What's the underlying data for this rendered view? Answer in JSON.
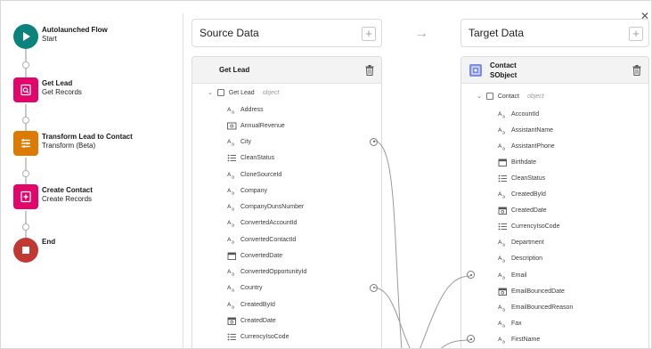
{
  "flow": {
    "steps": [
      {
        "title": "Autolaunched Flow",
        "subtitle": "Start",
        "icon": "play-icon",
        "color": "#0b827c",
        "shape": "circle"
      },
      {
        "title": "Get Lead",
        "subtitle": "Get Records",
        "icon": "search-record-icon",
        "color": "#e3066a",
        "shape": "square"
      },
      {
        "title": "Transform Lead to Contact",
        "subtitle": "Transform (Beta)",
        "icon": "transform-icon",
        "color": "#dd7a01",
        "shape": "square"
      },
      {
        "title": "Create Contact",
        "subtitle": "Create Records",
        "icon": "add-record-icon",
        "color": "#e3066a",
        "shape": "square"
      },
      {
        "title": "End",
        "subtitle": "",
        "icon": "stop-icon",
        "color": "#c23934",
        "shape": "circle"
      }
    ]
  },
  "source": {
    "header_title": "Source Data",
    "add_symbol": "+",
    "panel_title": "Get Lead",
    "root_label": "Get Lead",
    "root_type": "object",
    "fields": [
      {
        "name": "Address",
        "icon": "text"
      },
      {
        "name": "AnnualRevenue",
        "icon": "currency"
      },
      {
        "name": "City",
        "icon": "text",
        "connected": true
      },
      {
        "name": "CleanStatus",
        "icon": "list"
      },
      {
        "name": "CloneSourceId",
        "icon": "text"
      },
      {
        "name": "Company",
        "icon": "text"
      },
      {
        "name": "CompanyDunsNumber",
        "icon": "text"
      },
      {
        "name": "ConvertedAccountId",
        "icon": "text"
      },
      {
        "name": "ConvertedContactId",
        "icon": "text"
      },
      {
        "name": "ConvertedDate",
        "icon": "date"
      },
      {
        "name": "ConvertedOpportunityId",
        "icon": "text"
      },
      {
        "name": "Country",
        "icon": "text",
        "connected": true
      },
      {
        "name": "CreatedById",
        "icon": "text"
      },
      {
        "name": "CreatedDate",
        "icon": "datetime"
      },
      {
        "name": "CurrencyIsoCode",
        "icon": "list"
      }
    ]
  },
  "target": {
    "header_title": "Target Data",
    "add_symbol": "+",
    "panel_title": "Contact",
    "panel_subtitle": "SObject",
    "root_label": "Contact",
    "root_type": "object",
    "fields": [
      {
        "name": "AccountId",
        "icon": "text"
      },
      {
        "name": "AssistantName",
        "icon": "text"
      },
      {
        "name": "AssistantPhone",
        "icon": "text"
      },
      {
        "name": "Birthdate",
        "icon": "date"
      },
      {
        "name": "CleanStatus",
        "icon": "list"
      },
      {
        "name": "CreatedById",
        "icon": "text"
      },
      {
        "name": "CreatedDate",
        "icon": "datetime"
      },
      {
        "name": "CurrencyIsoCode",
        "icon": "list"
      },
      {
        "name": "Department",
        "icon": "text"
      },
      {
        "name": "Description",
        "icon": "text"
      },
      {
        "name": "Email",
        "icon": "text",
        "connected": true
      },
      {
        "name": "EmailBouncedDate",
        "icon": "datetime"
      },
      {
        "name": "EmailBouncedReason",
        "icon": "text"
      },
      {
        "name": "Fax",
        "icon": "text"
      },
      {
        "name": "FirstName",
        "icon": "text",
        "connected": true
      }
    ]
  },
  "arrow_symbol": "→",
  "close_symbol": "✕",
  "colors": {
    "wire": "#9a9a9a",
    "panel_head": "#f3f3f3"
  }
}
